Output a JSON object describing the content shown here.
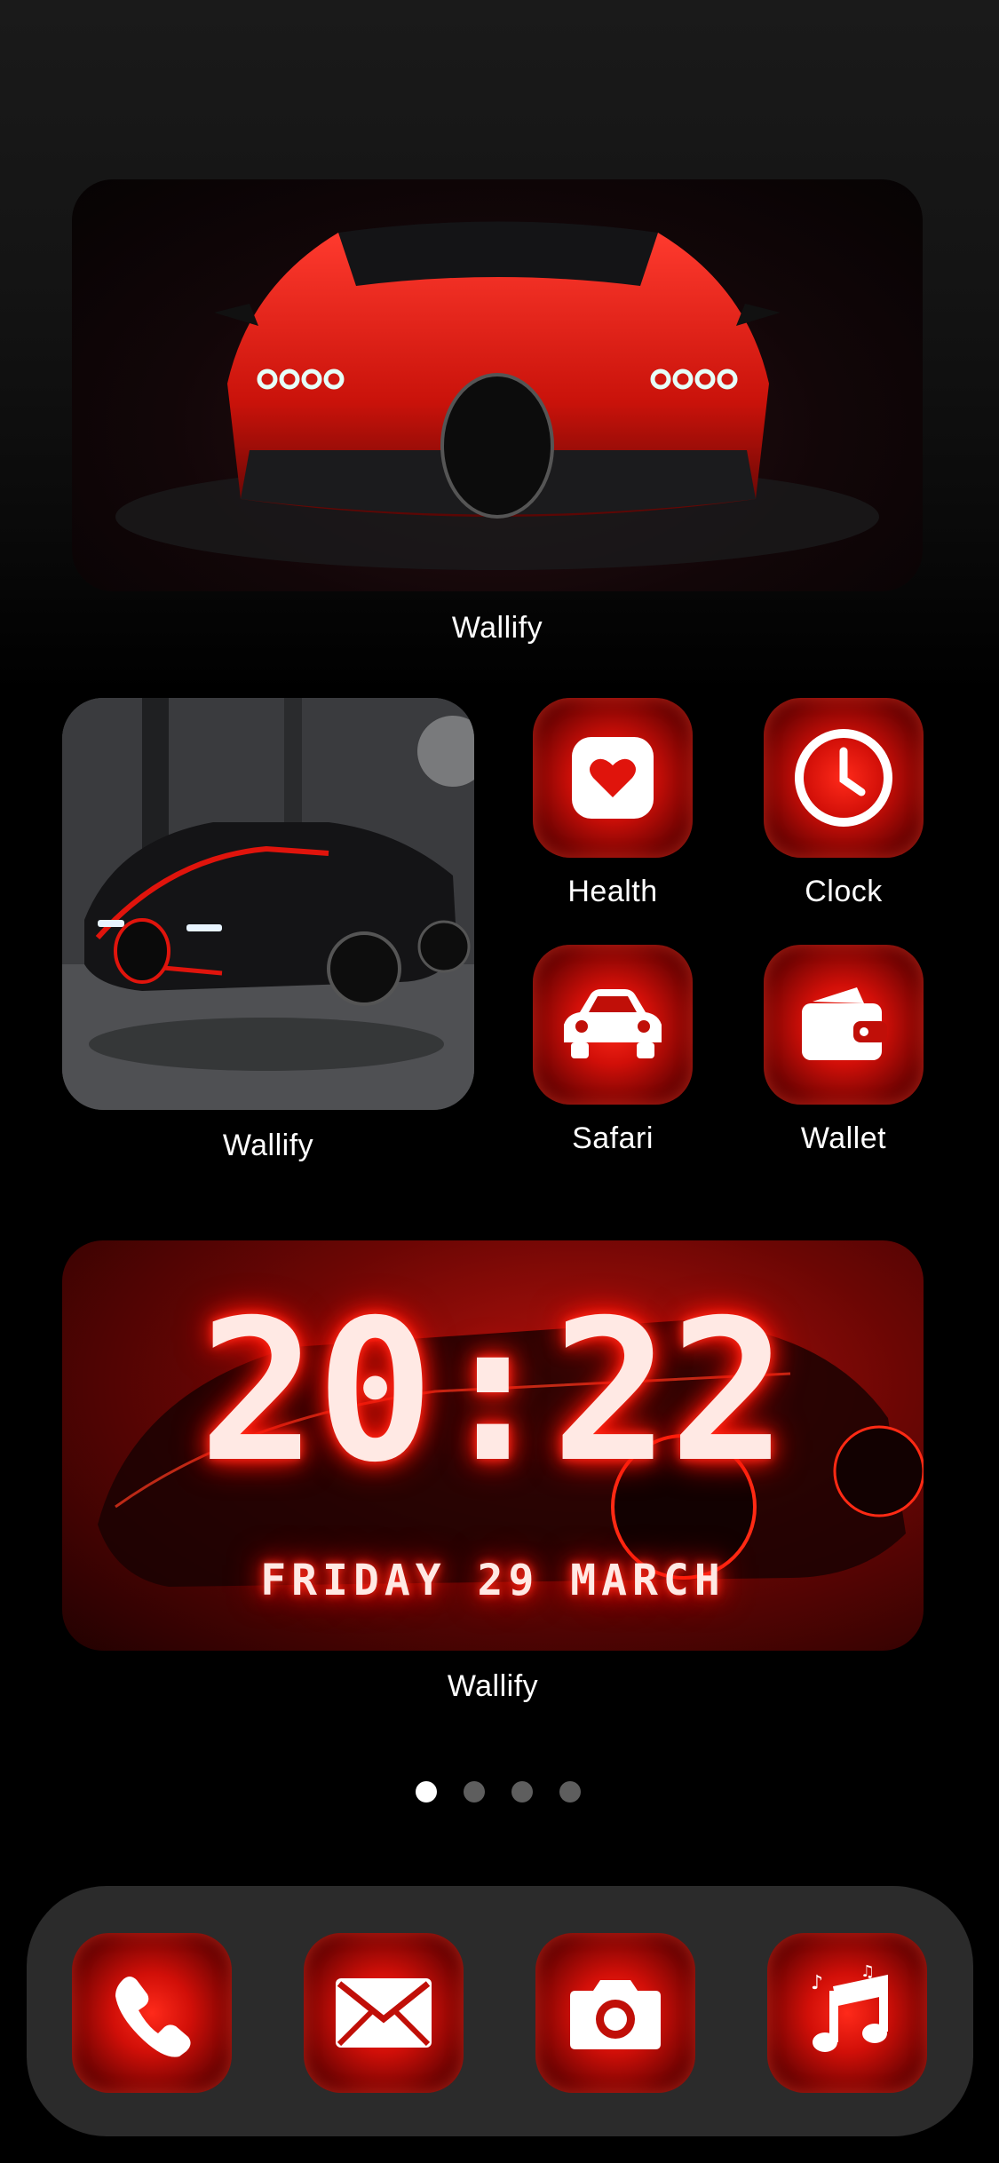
{
  "widgets": {
    "hero": {
      "label": "Wallify"
    },
    "garage": {
      "label": "Wallify"
    },
    "clock": {
      "label": "Wallify",
      "time": "20:22",
      "date": "FRIDAY 29 MARCH"
    }
  },
  "apps": [
    {
      "label": "Health",
      "icon": "health-heart-icon"
    },
    {
      "label": "Clock",
      "icon": "clock-icon"
    },
    {
      "label": "Safari",
      "icon": "car-icon"
    },
    {
      "label": "Wallet",
      "icon": "wallet-icon"
    }
  ],
  "dock": [
    {
      "icon": "phone-icon"
    },
    {
      "icon": "mail-icon"
    },
    {
      "icon": "camera-icon"
    },
    {
      "icon": "music-icon"
    }
  ],
  "page_indicator": {
    "count": 4,
    "active": 1
  },
  "colors": {
    "accent": "#e0120a",
    "background": "#000000",
    "dock": "#4e4e4e"
  }
}
